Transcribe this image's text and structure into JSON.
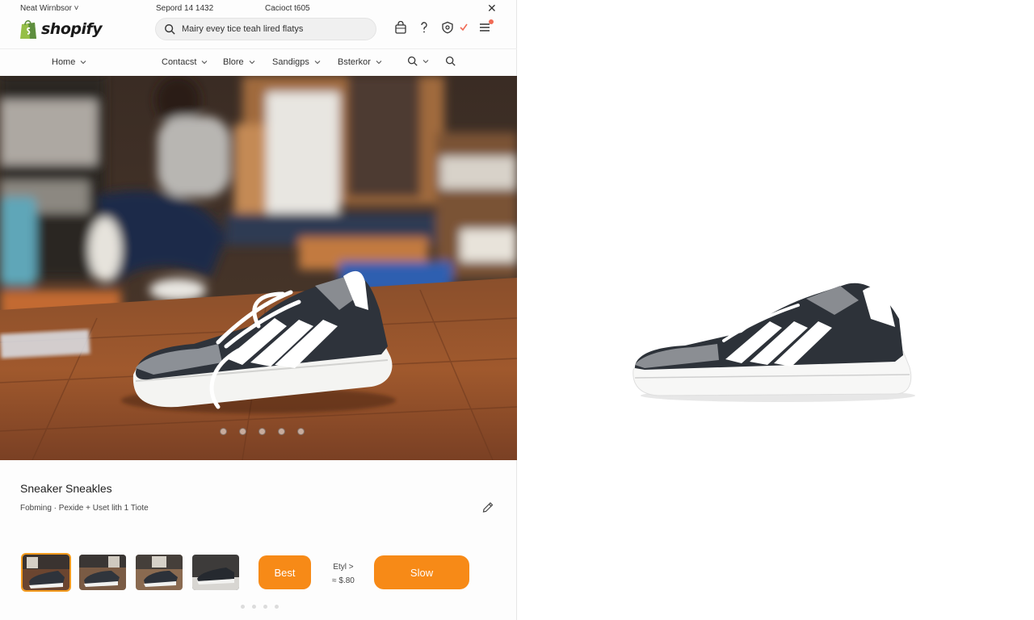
{
  "topbar": {
    "left_text": "Neat Wirnbsor ˅",
    "center_text": "Sepord 14 1432",
    "contact_text": "Cacioct t605",
    "close_label": "✕"
  },
  "header": {
    "logo_text": "shopify",
    "search": {
      "value": "Mairy evey tice teah lired flatys",
      "placeholder": ""
    },
    "icons": [
      "bag-icon",
      "help-icon",
      "shield-icon",
      "check-icon",
      "menu-icon"
    ]
  },
  "nav": {
    "items": [
      {
        "label": "Home"
      },
      {
        "label": "Contacst"
      },
      {
        "label": "Blore"
      },
      {
        "label": "Sandigps"
      },
      {
        "label": "Bsterkor"
      }
    ]
  },
  "product": {
    "title": "Sneaker Sneakles",
    "subtitle": "Fobming · Pexide + Uset lith 1 Tiote",
    "carousel_dots": 5
  },
  "actions": {
    "best_label": "Best",
    "price_line1": "Etyl >",
    "price_line2": "≈ $.80",
    "show_label": "Slow",
    "thumbnails": 4
  },
  "colors": {
    "accent": "#f78a17",
    "sneaker_dark": "#2c3038",
    "sneaker_grey": "#8a8d92"
  }
}
